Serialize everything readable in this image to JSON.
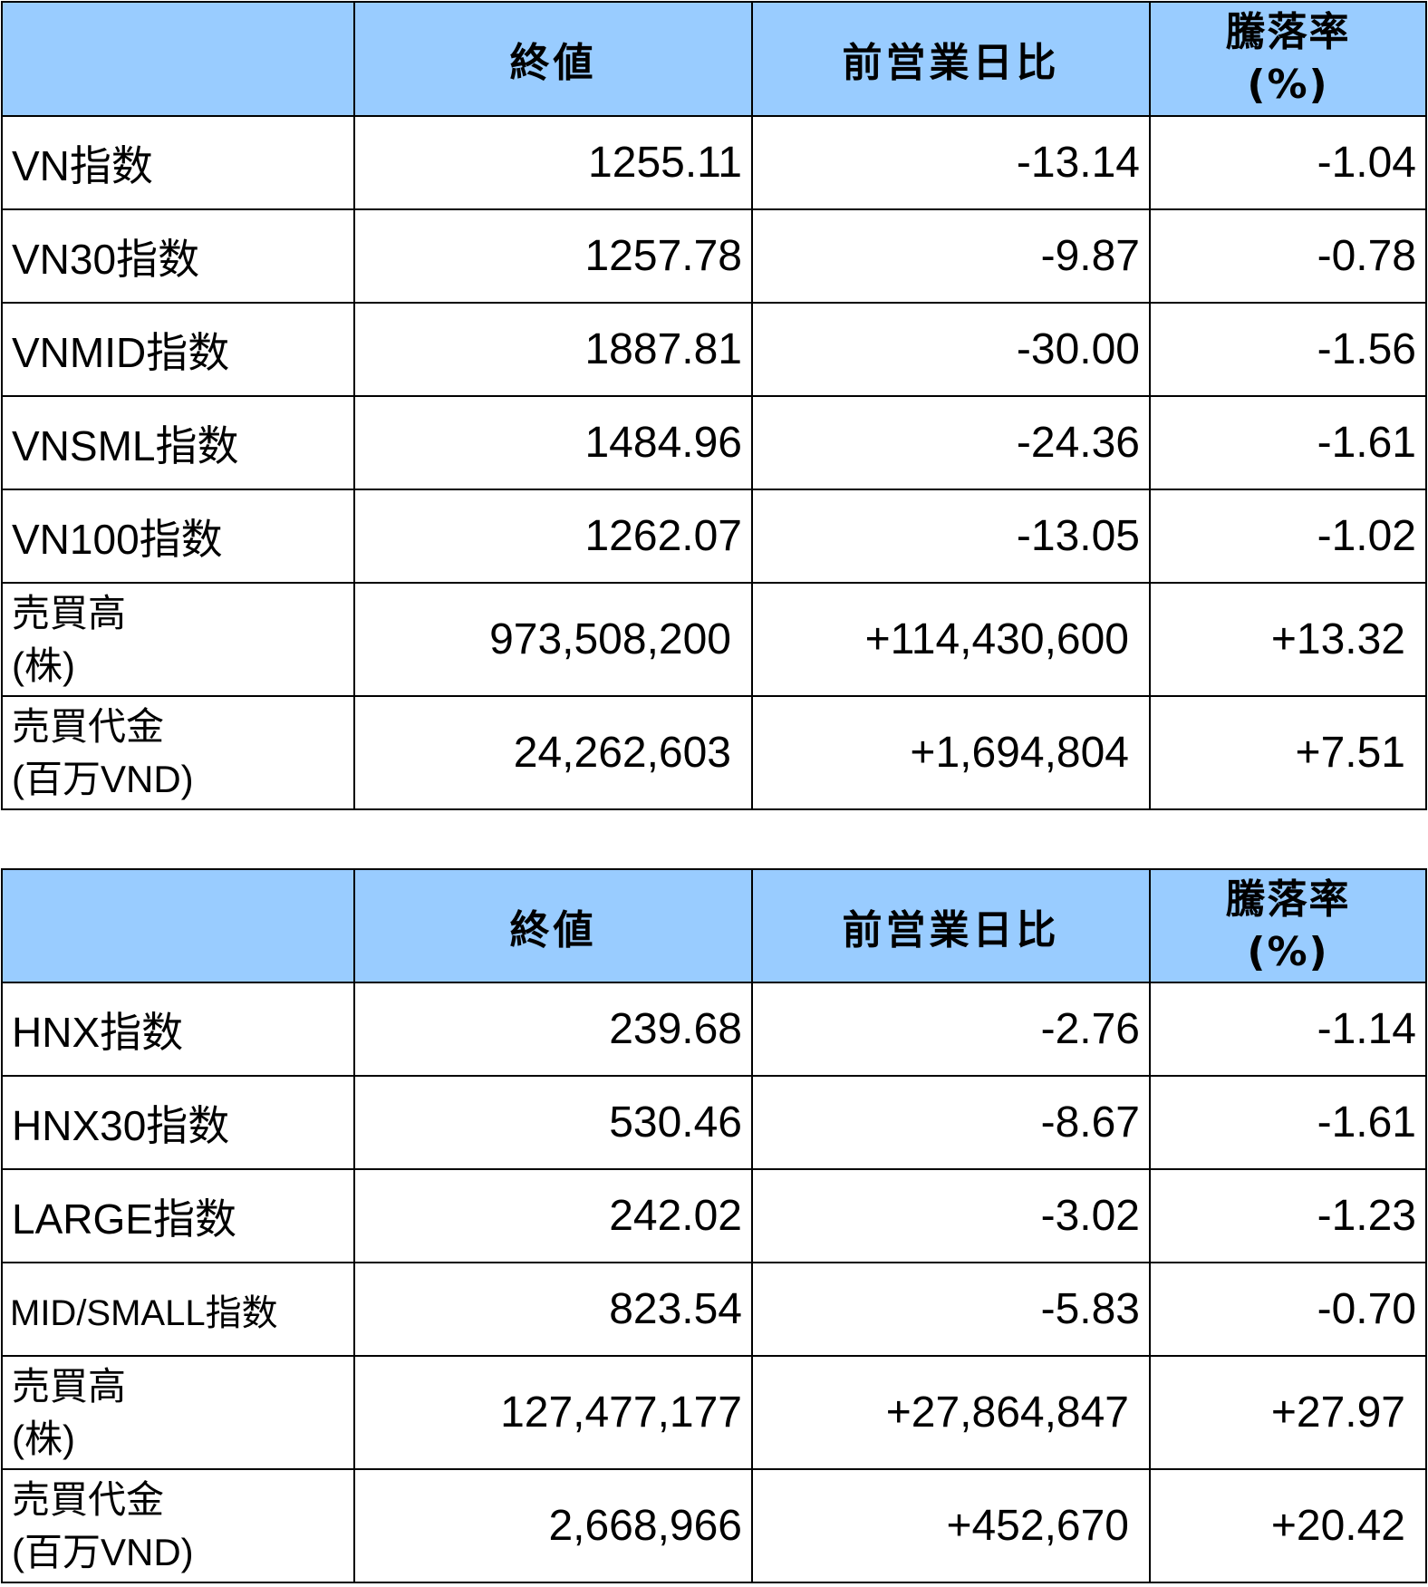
{
  "header": {
    "close": "終値",
    "change": "前営業日比",
    "rate_line1": "騰落率",
    "rate_line2": "(%)"
  },
  "table_hose": {
    "rows": [
      {
        "label": "VN指数",
        "close": "1255.11",
        "change": "-13.14",
        "rate": "-1.04"
      },
      {
        "label": "VN30指数",
        "close": "1257.78",
        "change": "-9.87",
        "rate": "-0.78"
      },
      {
        "label": "VNMID指数",
        "close": "1887.81",
        "change": "-30.00",
        "rate": "-1.56"
      },
      {
        "label": "VNSML指数",
        "close": "1484.96",
        "change": "-24.36",
        "rate": "-1.61"
      },
      {
        "label": "VN100指数",
        "close": "1262.07",
        "change": "-13.05",
        "rate": "-1.02"
      },
      {
        "label_line1": "売買高",
        "label_line2": "(株)",
        "close": "973,508,200",
        "change": "+114,430,600",
        "rate": "+13.32"
      },
      {
        "label_line1": "売買代金",
        "label_line2": "(百万VND)",
        "close": "24,262,603",
        "change": "+1,694,804",
        "rate": "+7.51"
      }
    ]
  },
  "table_hnx": {
    "rows": [
      {
        "label": "HNX指数",
        "close": "239.68",
        "change": "-2.76",
        "rate": "-1.14"
      },
      {
        "label": "HNX30指数",
        "close": "530.46",
        "change": "-8.67",
        "rate": "-1.61"
      },
      {
        "label": "LARGE指数",
        "close": "242.02",
        "change": "-3.02",
        "rate": "-1.23"
      },
      {
        "label": "MID/SMALL指数",
        "close": "823.54",
        "change": "-5.83",
        "rate": "-0.70"
      },
      {
        "label_line1": "売買高",
        "label_line2": "(株)",
        "close": "127,477,177",
        "change": "+27,864,847",
        "rate": "+27.97"
      },
      {
        "label_line1": "売買代金",
        "label_line2": "(百万VND)",
        "close": "2,668,966",
        "change": "+452,670",
        "rate": "+20.42"
      }
    ]
  }
}
